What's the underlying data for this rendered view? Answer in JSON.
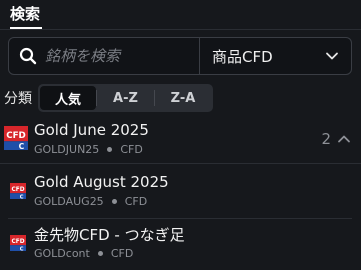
{
  "tabs": {
    "active_label": "検索"
  },
  "search": {
    "placeholder": "銘柄を検索",
    "value": ""
  },
  "category": {
    "selected": "商品CFD"
  },
  "sort": {
    "label": "分類",
    "options": [
      {
        "label": "人気",
        "active": true
      },
      {
        "label": "A-Z",
        "active": false
      },
      {
        "label": "Z-A",
        "active": false
      }
    ]
  },
  "items": [
    {
      "title": "Gold June 2025",
      "code": "GOLDJUN25",
      "type": "CFD",
      "group_count": "2",
      "icon_text": "CFD"
    },
    {
      "title": "Gold August 2025",
      "code": "GOLDAUG25",
      "type": "CFD",
      "icon_text": "CFD"
    },
    {
      "title": "金先物CFD - つなぎ足",
      "code": "GOLDcont",
      "type": "CFD",
      "icon_text": "CFD"
    }
  ],
  "colors": {
    "background": "#16181c",
    "cfd_red": "#d7262b",
    "cfd_blue": "#1f4fa8"
  }
}
